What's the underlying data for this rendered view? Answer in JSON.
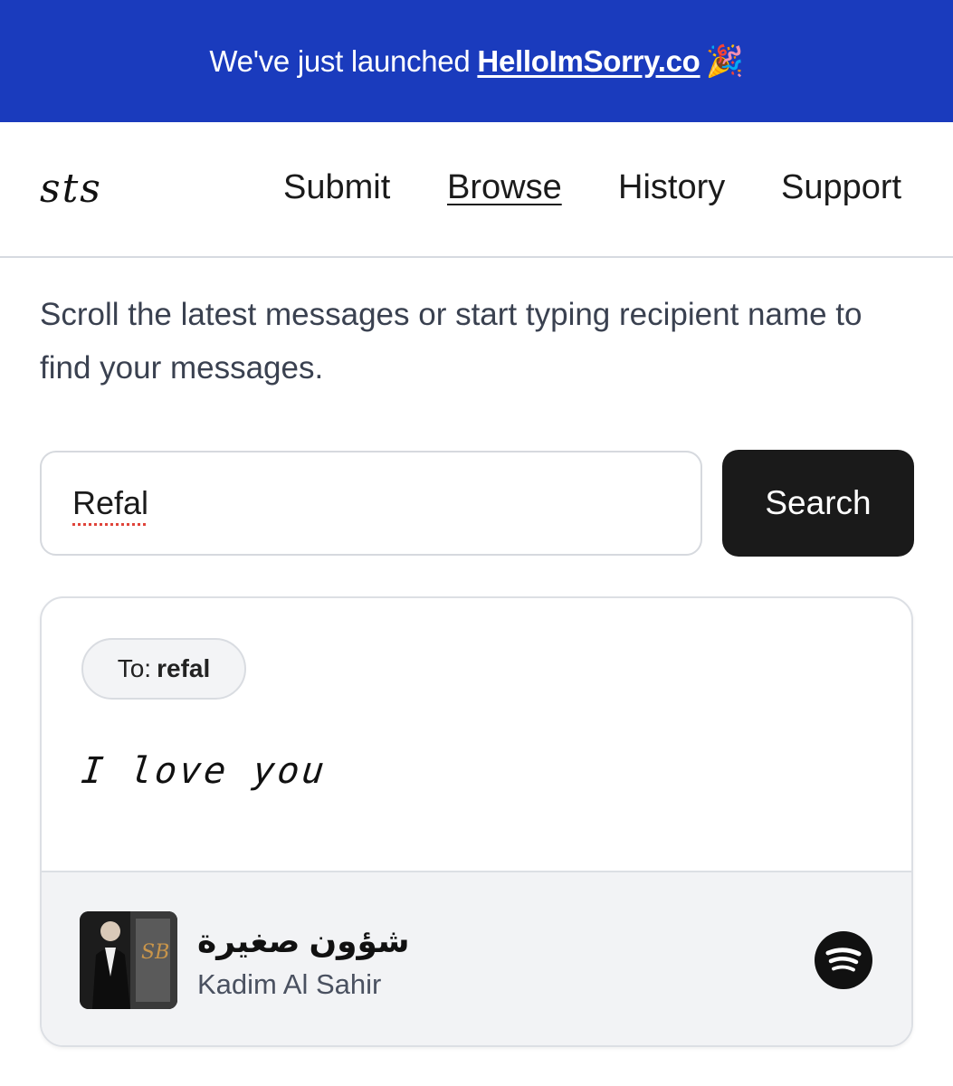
{
  "banner": {
    "text": "We've just launched",
    "link": "HelloImSorry.co",
    "emoji": "🎉"
  },
  "nav": {
    "logo": "sts",
    "links": [
      "Submit",
      "Browse",
      "History",
      "Support"
    ],
    "active": "Browse"
  },
  "intro": "Scroll the latest messages or start typing recipient name to find your messages.",
  "search": {
    "value": "Refal",
    "button_label": "Search"
  },
  "card": {
    "to_label": "To:",
    "recipient": "refal",
    "message": "I love you",
    "song": {
      "title": "شؤون صغيرة",
      "artist": "Kadim Al Sahir",
      "service_icon": "spotify-icon"
    }
  }
}
